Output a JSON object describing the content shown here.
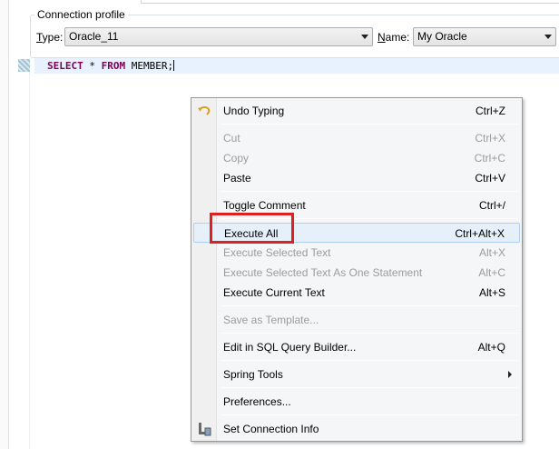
{
  "connection_profile": {
    "legend": "Connection profile",
    "type_label": "Type:",
    "type_value": "Oracle_11",
    "name_label": "Name:",
    "name_value": "My Oracle"
  },
  "editor": {
    "code": {
      "kw1": "SELECT",
      "t1": " * ",
      "kw2": "FROM",
      "t2": " MEMBER;"
    }
  },
  "context_menu": {
    "items": [
      {
        "label": "Undo Typing",
        "shortcut": "Ctrl+Z",
        "enabled": true,
        "icon": "undo-icon"
      },
      {
        "label": "Cut",
        "shortcut": "Ctrl+X",
        "enabled": false
      },
      {
        "label": "Copy",
        "shortcut": "Ctrl+C",
        "enabled": false
      },
      {
        "label": "Paste",
        "shortcut": "Ctrl+V",
        "enabled": true
      },
      {
        "label": "Toggle Comment",
        "shortcut": "Ctrl+/",
        "enabled": true
      },
      {
        "label": "Execute All",
        "shortcut": "Ctrl+Alt+X",
        "enabled": true,
        "highlighted": true
      },
      {
        "label": "Execute Selected Text",
        "shortcut": "Alt+X",
        "enabled": false
      },
      {
        "label": "Execute Selected Text As One Statement",
        "shortcut": "Alt+C",
        "enabled": false
      },
      {
        "label": "Execute Current Text",
        "shortcut": "Alt+S",
        "enabled": true
      },
      {
        "label": "Save as Template...",
        "shortcut": "",
        "enabled": false
      },
      {
        "label": "Edit in SQL Query Builder...",
        "shortcut": "Alt+Q",
        "enabled": true
      },
      {
        "label": "Spring Tools",
        "shortcut": "",
        "enabled": true,
        "submenu": true
      },
      {
        "label": "Preferences...",
        "shortcut": "",
        "enabled": true
      },
      {
        "label": "Set Connection Info",
        "shortcut": "",
        "enabled": true,
        "icon": "connection-info-icon"
      }
    ]
  },
  "colors": {
    "keyword": "#7f0055",
    "highlight_box": "#e0201f",
    "menu_hover": "#e5f0fb"
  }
}
